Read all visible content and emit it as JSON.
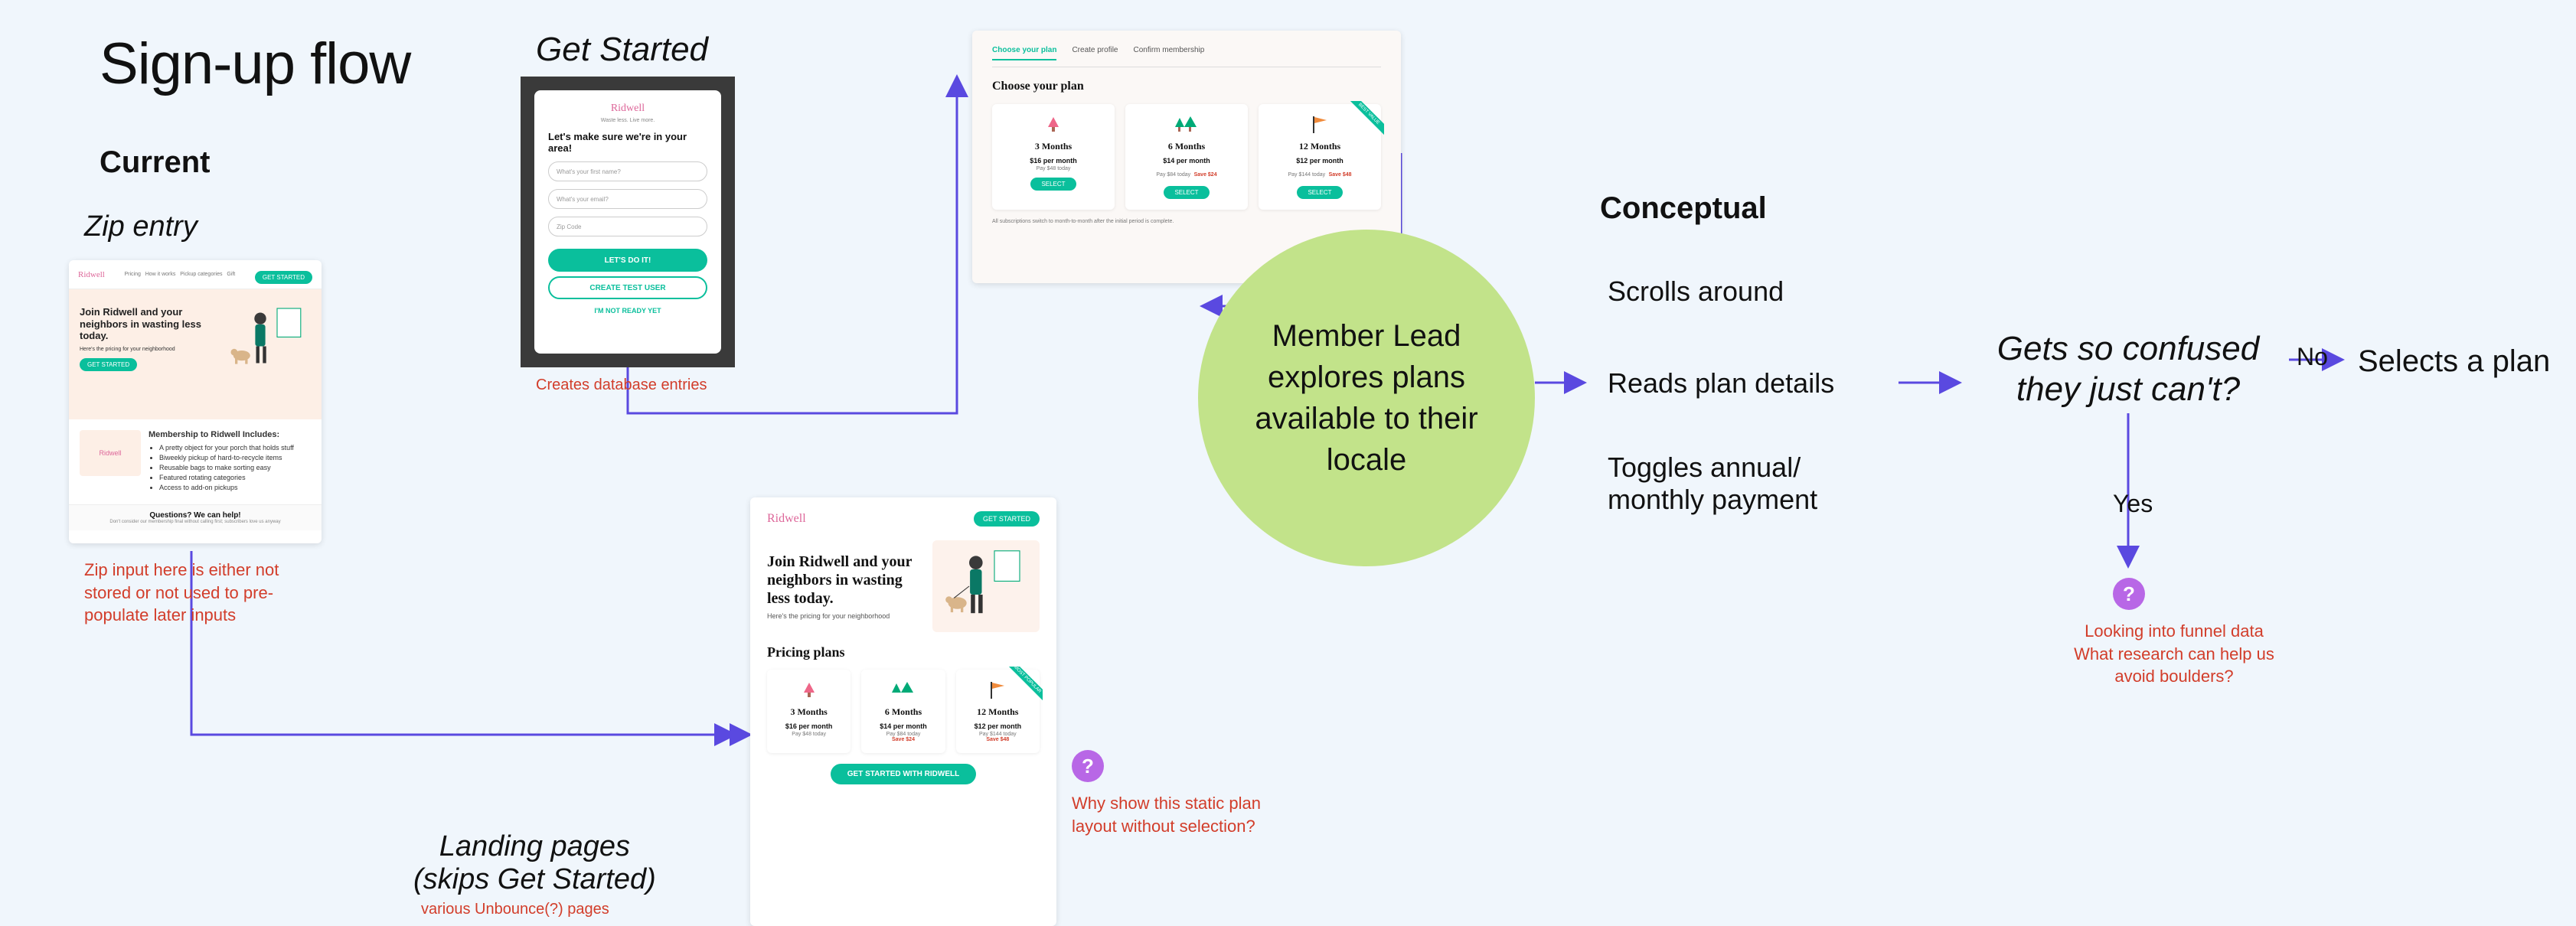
{
  "title": "Sign-up flow",
  "sections": {
    "current": "Current",
    "conceptual": "Conceptual"
  },
  "nodes": {
    "zip_entry_label": "Zip entry",
    "get_started_label": "Get Started",
    "landing_label": "Landing pages\n(skips Get Started)",
    "circle": "Member Lead explores plans available to their locale",
    "actions": {
      "scrolls": "Scrolls around",
      "reads": "Reads plan details",
      "toggles": "Toggles annual/\nmonthly payment"
    },
    "confused": "Gets so confused they just can't?",
    "selects": "Selects a plan",
    "branch_no": "No",
    "branch_yes": "Yes"
  },
  "notes": {
    "zip": "Zip input here is either not stored or not used to pre-populate later inputs",
    "gs": "Creates database entries",
    "landing": "various Unbounce(?) pages",
    "plan_static": "Why show this static plan layout without selection?",
    "funnel": "Looking into funnel data\nWhat research can help us avoid boulders?"
  },
  "mock_zip": {
    "logo": "Ridwell",
    "nav": [
      "Pricing",
      "How it works",
      "Pickup categories",
      "Gift"
    ],
    "headline": "Join Ridwell and your neighbors in wasting less today.",
    "sub": "Here's the pricing for your neighborhood",
    "cta": "GET STARTED",
    "includes_title": "Membership to Ridwell Includes:",
    "includes": [
      "A pretty object for your porch that holds stuff",
      "Biweekly pickup of hard-to-recycle items",
      "Reusable bags to make sorting easy",
      "Featured rotating categories",
      "Access to add-on pickups"
    ],
    "foot": "Questions? We can help!",
    "foot_sub": "Don't consider our membership final without calling first; subscribers love us anyway"
  },
  "mock_gs": {
    "logo": "Ridwell",
    "tagline": "Waste less. Live more.",
    "headline": "Let's make sure we're in your area!",
    "fields": {
      "first": "What's your first name?",
      "email": "What's your email?",
      "zip": "Zip Code"
    },
    "btn_go": "LET'S DO IT!",
    "btn_test": "CREATE TEST USER",
    "link_notready": "I'M NOT READY YET"
  },
  "mock_plan": {
    "tabs": [
      "Choose your plan",
      "Create profile",
      "Confirm membership"
    ],
    "title": "Choose your plan",
    "plans": [
      {
        "name": "3 Months",
        "price": "$16 per month",
        "pay": "Pay $48 today",
        "save": ""
      },
      {
        "name": "6 Months",
        "price": "$14 per month",
        "pay": "Pay $84 today",
        "save": "Save $24"
      },
      {
        "name": "12 Months",
        "price": "$12 per month",
        "pay": "Pay $144 today",
        "save": "Save $48",
        "badge": "BEST VALUE"
      }
    ],
    "select": "SELECT",
    "footnote": "All subscriptions switch to month-to-month after the initial period is complete."
  },
  "mock_land": {
    "logo": "Ridwell",
    "cta_top": "GET STARTED",
    "headline": "Join Ridwell and your neighbors in wasting less today.",
    "sub": "Here's the pricing for your neighborhood",
    "pricing_title": "Pricing plans",
    "plans": [
      {
        "name": "3 Months",
        "price": "$16 per month",
        "pay": "Pay $48 today",
        "save": ""
      },
      {
        "name": "6 Months",
        "price": "$14 per month",
        "pay": "Pay $84 today",
        "save": "Save $24"
      },
      {
        "name": "12 Months",
        "price": "$12 per month",
        "pay": "Pay $144 today",
        "save": "Save $48",
        "badge": "MOST POPULAR"
      }
    ],
    "cta_big": "GET STARTED WITH RIDWELL"
  }
}
